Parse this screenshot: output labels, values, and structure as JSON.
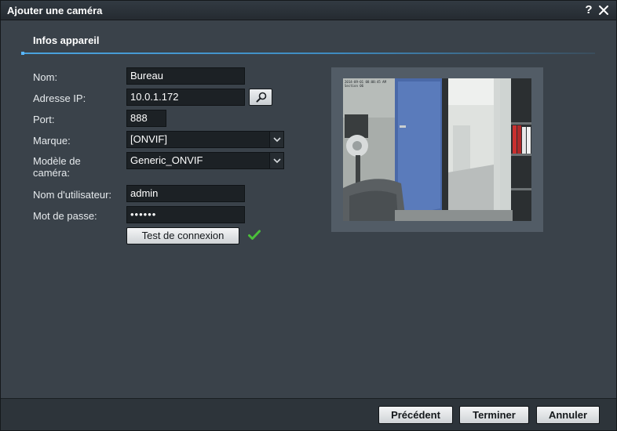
{
  "window": {
    "title": "Ajouter une caméra",
    "help_label": "?"
  },
  "section": {
    "title": "Infos appareil"
  },
  "form": {
    "name_label": "Nom:",
    "name_value": "Bureau",
    "ip_label": "Adresse IP:",
    "ip_value": "10.0.1.172",
    "port_label": "Port:",
    "port_value": "888",
    "brand_label": "Marque:",
    "brand_value": "[ONVIF]",
    "model_label_1": "Modèle de",
    "model_label_2": "caméra:",
    "model_value": "Generic_ONVIF",
    "user_label": "Nom d'utilisateur:",
    "user_value": "admin",
    "password_label": "Mot de passe:",
    "password_value": "••••••",
    "test_button": "Test de connexion",
    "test_status": "success"
  },
  "preview": {
    "timestamp_line_1": "2014-09-01 08:08:45 AM",
    "timestamp_line_2": "Section 06"
  },
  "footer": {
    "previous_label": "Précédent",
    "finish_label": "Terminer",
    "cancel_label": "Annuler"
  },
  "colors": {
    "accent": "#4aa3df",
    "success": "#4bbf3a",
    "window_bg": "#3a424a",
    "field_bg": "#1c2125"
  },
  "icons": {
    "close": "close-icon",
    "search": "search-icon",
    "dropdown": "chevron-down-icon",
    "status": "checkmark-icon"
  }
}
